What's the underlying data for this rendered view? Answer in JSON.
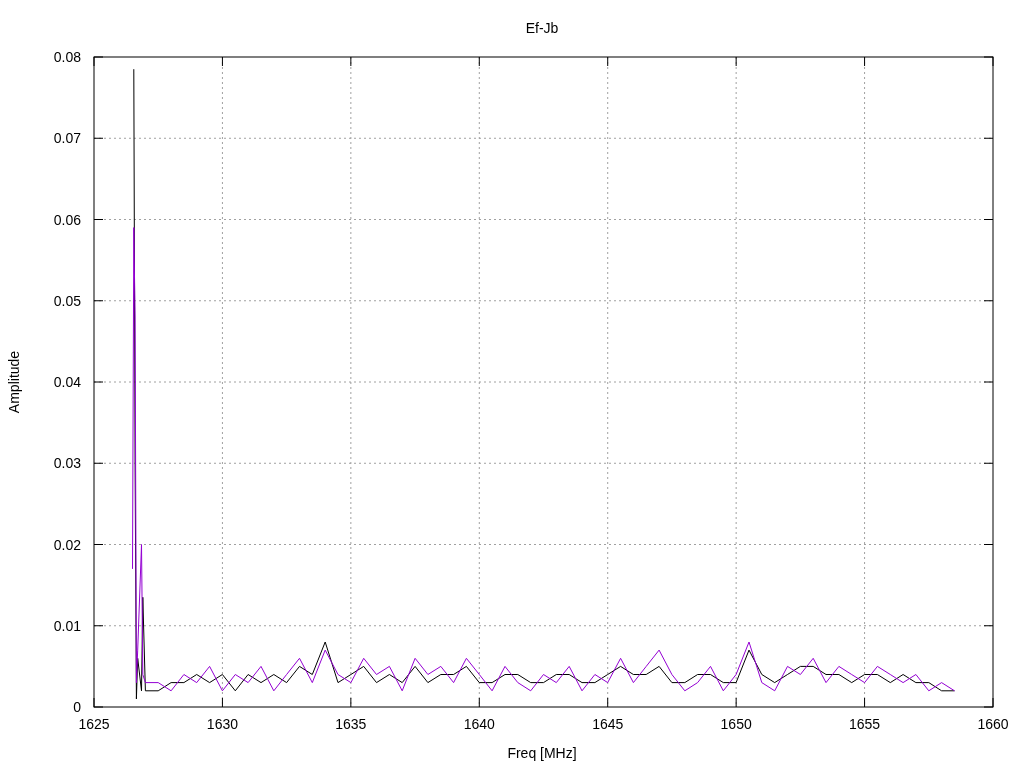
{
  "plot": {
    "chart_data": {
      "type": "line",
      "title": "Ef-Jb",
      "xlabel": "Freq [MHz]",
      "ylabel": "Amplitude",
      "grid": true,
      "xlim": [
        1625,
        1660
      ],
      "ylim": [
        0,
        0.08
      ],
      "xticks": [
        1625,
        1630,
        1635,
        1640,
        1645,
        1650,
        1655,
        1660
      ],
      "yticks": [
        0,
        0.01,
        0.02,
        0.03,
        0.04,
        0.05,
        0.06,
        0.07,
        0.08
      ],
      "x": [
        1626.5,
        1626.55,
        1626.6,
        1626.65,
        1626.7,
        1626.85,
        1626.9,
        1627.0,
        1627.5,
        1628,
        1628.5,
        1629,
        1629.5,
        1630,
        1630.5,
        1631,
        1631.5,
        1632,
        1632.5,
        1633,
        1633.5,
        1634,
        1634.5,
        1635,
        1635.5,
        1636,
        1636.5,
        1637,
        1637.5,
        1638,
        1638.5,
        1639,
        1639.5,
        1640,
        1640.5,
        1641,
        1641.5,
        1642,
        1642.5,
        1643,
        1643.5,
        1644,
        1644.5,
        1645,
        1645.5,
        1646,
        1646.5,
        1647,
        1647.5,
        1648,
        1648.5,
        1649,
        1649.5,
        1650,
        1650.5,
        1651,
        1651.5,
        1652,
        1652.5,
        1653,
        1653.5,
        1654,
        1654.5,
        1655,
        1655.5,
        1656,
        1656.5,
        1657,
        1657.5,
        1658,
        1658.5
      ],
      "series": [
        {
          "color": "#000000",
          "values": [
            null,
            0.0785,
            0.03,
            0.001,
            0.006,
            0.002,
            0.0135,
            0.002,
            0.002,
            0.003,
            0.003,
            0.004,
            0.003,
            0.004,
            0.002,
            0.004,
            0.003,
            0.004,
            0.003,
            0.005,
            0.004,
            0.008,
            0.003,
            0.004,
            0.005,
            0.003,
            0.004,
            0.003,
            0.005,
            0.003,
            0.004,
            0.004,
            0.005,
            0.003,
            0.003,
            0.004,
            0.004,
            0.003,
            0.003,
            0.004,
            0.004,
            0.003,
            0.003,
            0.004,
            0.005,
            0.004,
            0.004,
            0.005,
            0.003,
            0.003,
            0.004,
            0.004,
            0.003,
            0.003,
            0.007,
            0.004,
            0.003,
            0.004,
            0.005,
            0.005,
            0.004,
            0.004,
            0.003,
            0.004,
            0.004,
            0.003,
            0.004,
            0.003,
            0.003,
            0.002,
            0.002
          ]
        },
        {
          "color": "#9400d3",
          "values": [
            0.017,
            0.059,
            0.048,
            0.003,
            0.007,
            0.02,
            0.004,
            0.003,
            0.003,
            0.002,
            0.004,
            0.003,
            0.005,
            0.002,
            0.004,
            0.003,
            0.005,
            0.002,
            0.004,
            0.006,
            0.003,
            0.007,
            0.004,
            0.003,
            0.006,
            0.004,
            0.005,
            0.002,
            0.006,
            0.004,
            0.005,
            0.003,
            0.006,
            0.004,
            0.002,
            0.005,
            0.003,
            0.002,
            0.004,
            0.003,
            0.005,
            0.002,
            0.004,
            0.003,
            0.006,
            0.003,
            0.005,
            0.007,
            0.004,
            0.002,
            0.003,
            0.005,
            0.002,
            0.004,
            0.008,
            0.003,
            0.002,
            0.005,
            0.004,
            0.006,
            0.003,
            0.005,
            0.004,
            0.003,
            0.005,
            0.004,
            0.003,
            0.004,
            0.002,
            0.003,
            0.002
          ]
        }
      ]
    }
  }
}
